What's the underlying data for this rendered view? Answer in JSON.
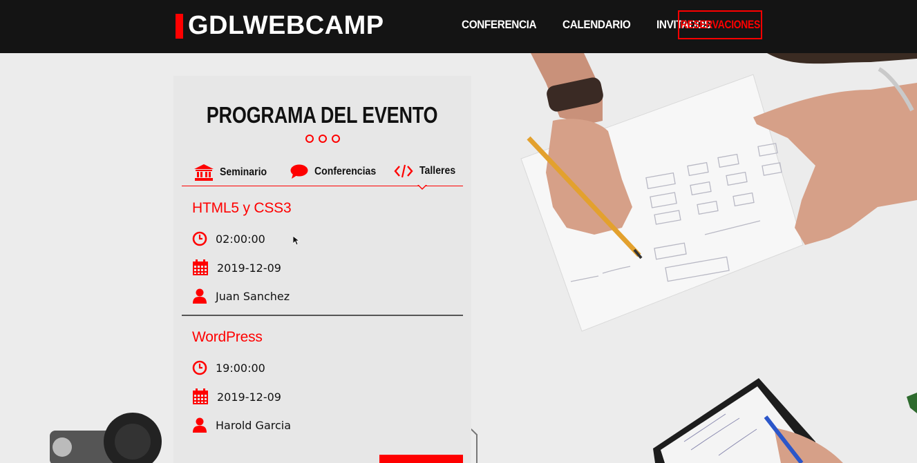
{
  "site": {
    "logo": "GDLWEBCAMP"
  },
  "nav": {
    "links": [
      "CONFERENCIA",
      "CALENDARIO",
      "INVITADOS"
    ],
    "cta": "RESERVACIONES"
  },
  "program": {
    "title": "PROGRAMA DEL EVENTO",
    "tabs": [
      {
        "label": "Seminario",
        "icon": "bank-icon"
      },
      {
        "label": "Conferencias",
        "icon": "speech-bubble-icon"
      },
      {
        "label": "Talleres",
        "icon": "code-icon",
        "active": true
      }
    ],
    "events": [
      {
        "title": "HTML5 y CSS3",
        "time": "02:00:00",
        "date": "2019-12-09",
        "speaker": "Juan Sanchez"
      },
      {
        "title": "WordPress",
        "time": "19:00:00",
        "date": "2019-12-09",
        "speaker": "Harold Garcia"
      }
    ]
  },
  "colors": {
    "accent": "#fe0000",
    "header_bg": "#141414",
    "panel_bg": "#e7e7e7"
  }
}
